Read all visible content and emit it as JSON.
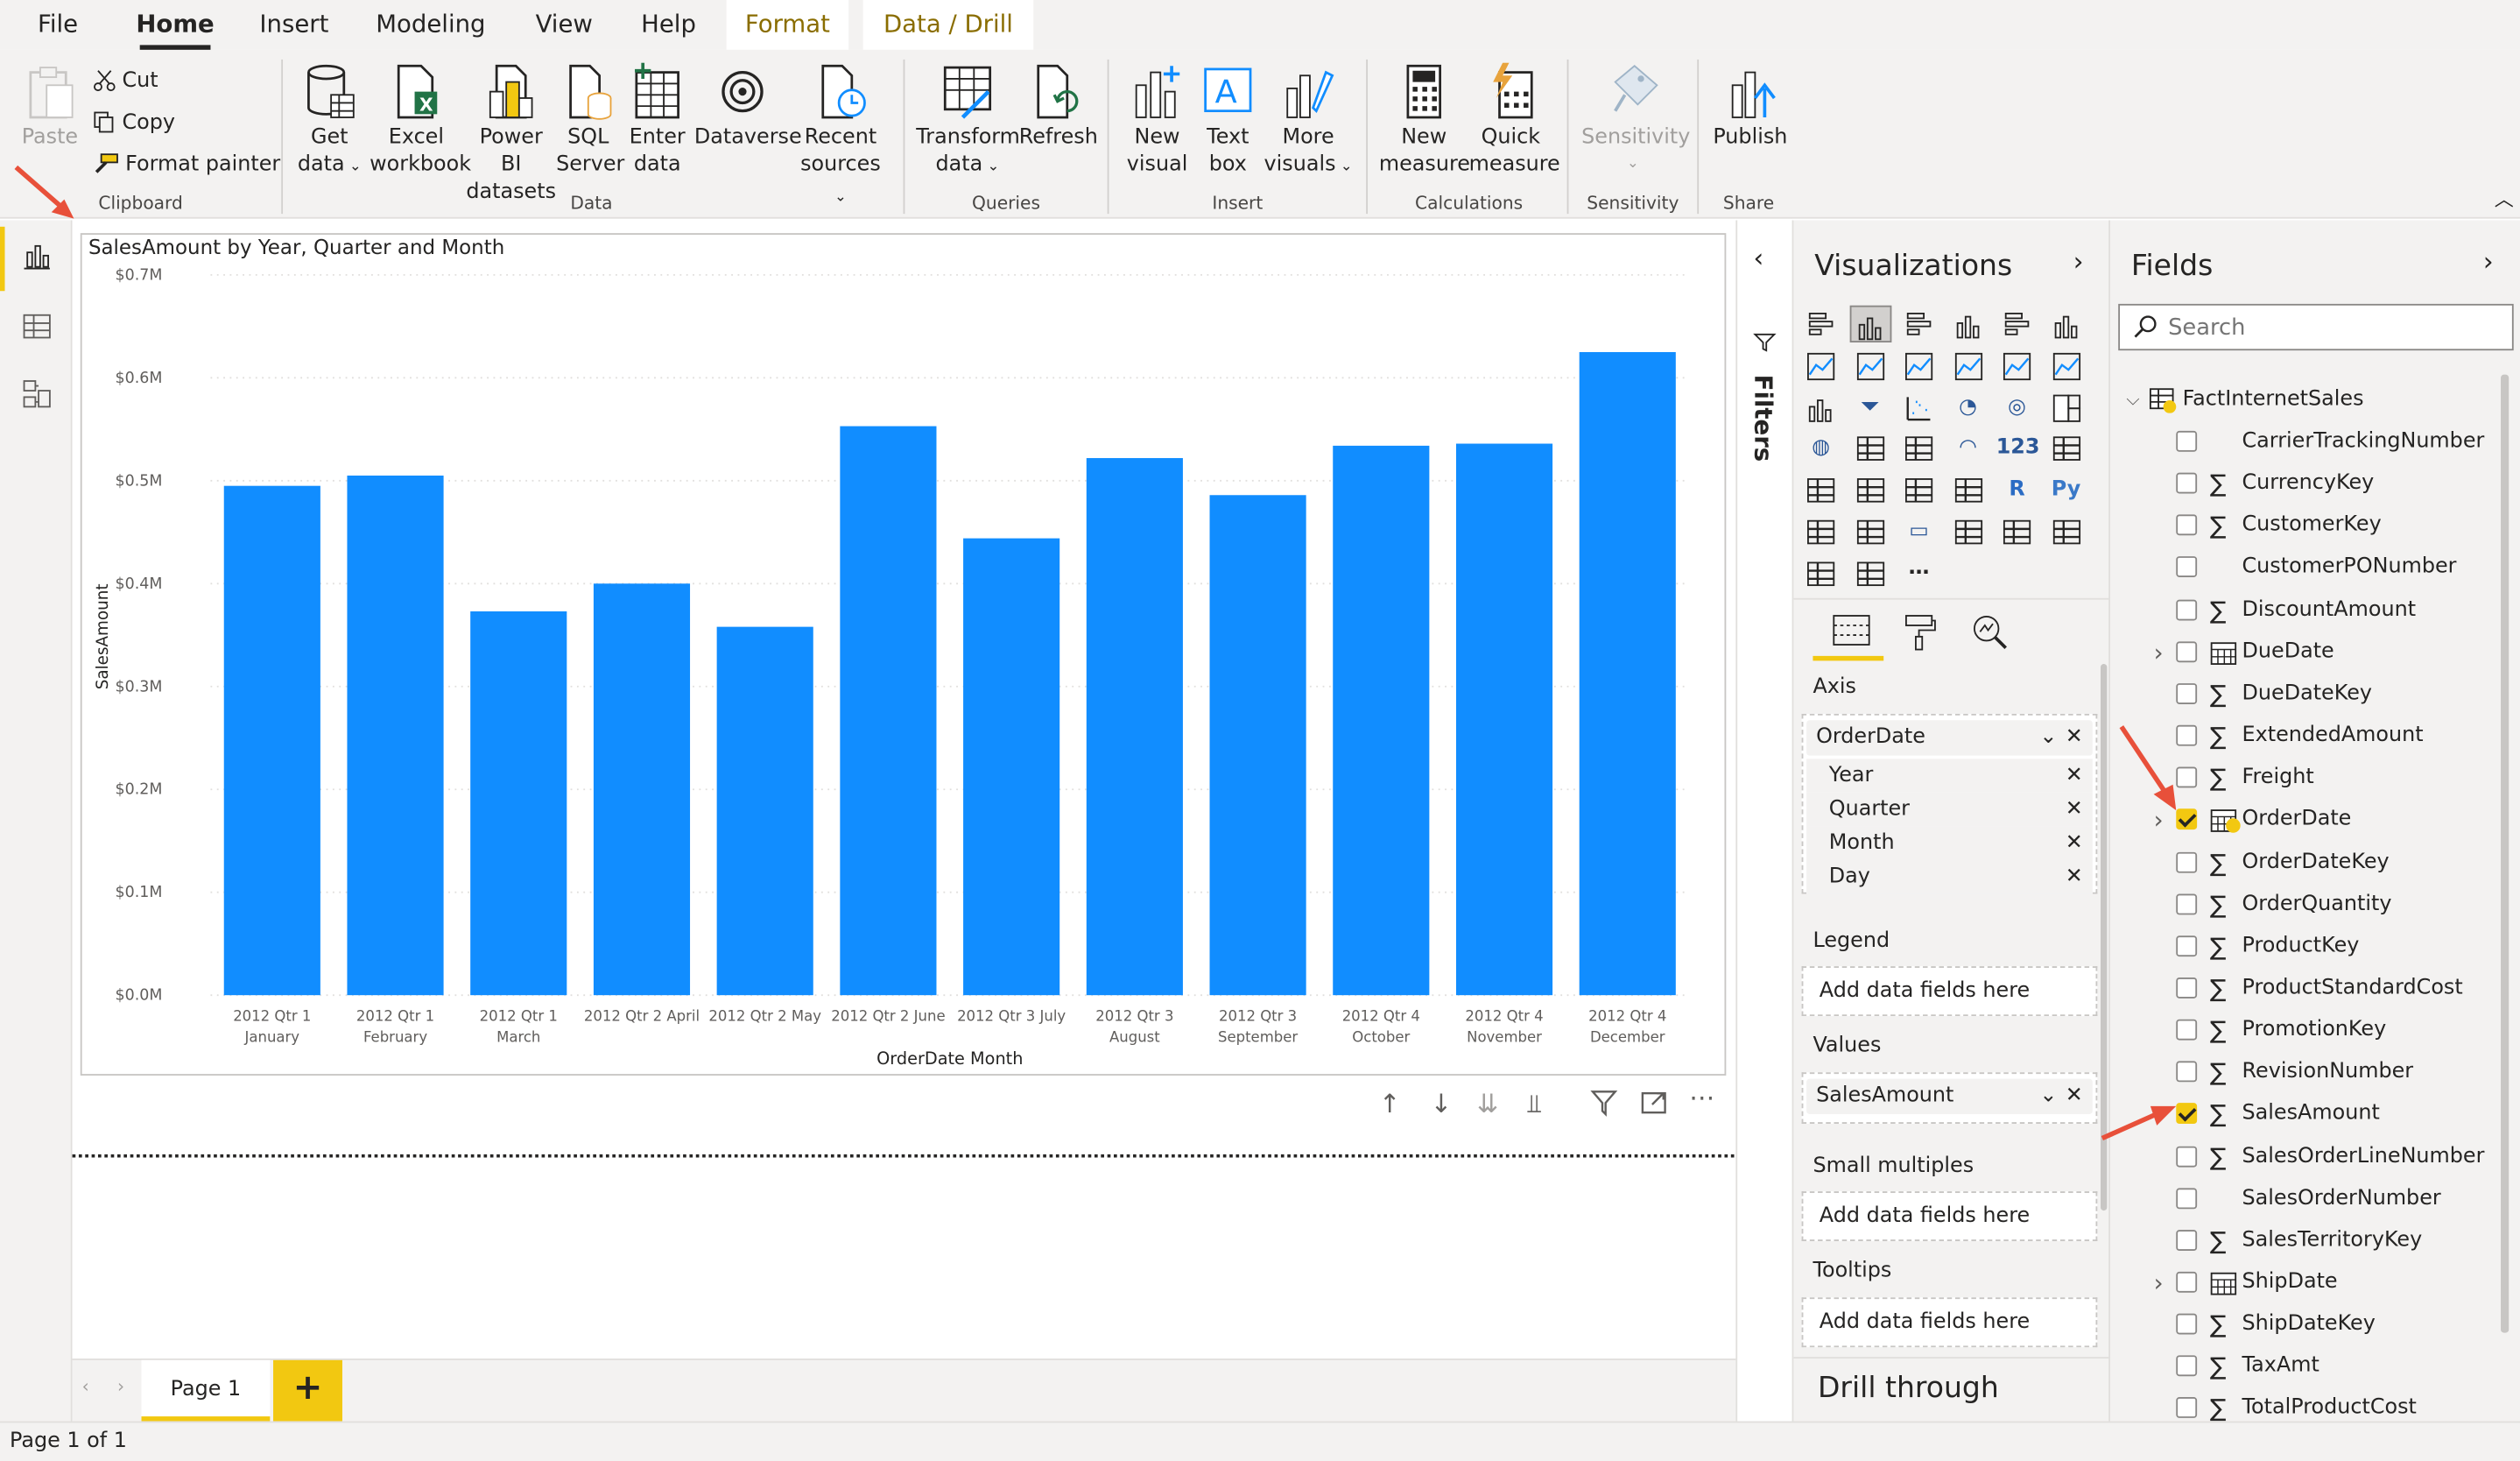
{
  "menu": {
    "tabs": [
      "File",
      "Home",
      "Insert",
      "Modeling",
      "View",
      "Help",
      "Format",
      "Data / Drill"
    ]
  },
  "ribbon": {
    "clipboard": {
      "paste": "Paste",
      "cut": "Cut",
      "copy": "Copy",
      "format_painter": "Format painter",
      "group": "Clipboard"
    },
    "data": {
      "get_data_1": "Get",
      "get_data_2": "data",
      "excel_1": "Excel",
      "excel_2": "workbook",
      "pbi_1": "Power BI",
      "pbi_2": "datasets",
      "sql_1": "SQL",
      "sql_2": "Server",
      "enter_1": "Enter",
      "enter_2": "data",
      "dataverse": "Dataverse",
      "recent_1": "Recent",
      "recent_2": "sources",
      "group": "Data"
    },
    "queries": {
      "transform_1": "Transform",
      "transform_2": "data",
      "refresh": "Refresh",
      "group": "Queries"
    },
    "insert": {
      "new_visual_1": "New",
      "new_visual_2": "visual",
      "text_box_1": "Text",
      "text_box_2": "box",
      "more_1": "More",
      "more_2": "visuals",
      "group": "Insert"
    },
    "calculations": {
      "new_measure_1": "New",
      "new_measure_2": "measure",
      "quick_1": "Quick",
      "quick_2": "measure",
      "group": "Calculations"
    },
    "sensitivity": {
      "label": "Sensitivity",
      "group": "Sensitivity"
    },
    "share": {
      "publish": "Publish",
      "group": "Share"
    }
  },
  "chart_data": {
    "type": "bar",
    "title": "SalesAmount by Year, Quarter and Month",
    "xlabel": "OrderDate Month",
    "ylabel": "SalesAmount",
    "ylim": [
      0,
      0.7
    ],
    "yticks": [
      "$0.0M",
      "$0.1M",
      "$0.2M",
      "$0.3M",
      "$0.4M",
      "$0.5M",
      "$0.6M",
      "$0.7M"
    ],
    "categories": [
      [
        "2012 Qtr 1",
        "January"
      ],
      [
        "2012 Qtr 1",
        "February"
      ],
      [
        "2012 Qtr 1",
        "March"
      ],
      [
        "2012 Qtr 2 April",
        ""
      ],
      [
        "2012 Qtr 2 May",
        ""
      ],
      [
        "2012 Qtr 2 June",
        ""
      ],
      [
        "2012 Qtr 3 July",
        ""
      ],
      [
        "2012 Qtr 3",
        "August"
      ],
      [
        "2012 Qtr 3",
        "September"
      ],
      [
        "2012 Qtr 4",
        "October"
      ],
      [
        "2012 Qtr 4",
        "November"
      ],
      [
        "2012 Qtr 4",
        "December"
      ]
    ],
    "values": [
      0.495,
      0.505,
      0.373,
      0.4,
      0.358,
      0.553,
      0.444,
      0.522,
      0.486,
      0.534,
      0.536,
      0.625
    ],
    "color": "#118dff",
    "grid": true
  },
  "pages": {
    "tab": "Page 1",
    "add": "+"
  },
  "status": "Page 1 of 1",
  "filters": {
    "label": "Filters"
  },
  "viz": {
    "title": "Visualizations",
    "axis_label": "Axis",
    "axis_field": "OrderDate",
    "axis_sub": [
      "Year",
      "Quarter",
      "Month",
      "Day"
    ],
    "legend_label": "Legend",
    "values_label": "Values",
    "values_field": "SalesAmount",
    "small_multiples_label": "Small multiples",
    "tooltips_label": "Tooltips",
    "add_placeholder": "Add data fields here",
    "drill_through": "Drill through"
  },
  "fields": {
    "title": "Fields",
    "search_placeholder": "Search",
    "table": "FactInternetSales",
    "items": [
      {
        "name": "CarrierTrackingNumber",
        "type": "text",
        "checked": false
      },
      {
        "name": "CurrencyKey",
        "type": "sigma",
        "checked": false
      },
      {
        "name": "CustomerKey",
        "type": "sigma",
        "checked": false
      },
      {
        "name": "CustomerPONumber",
        "type": "text",
        "checked": false
      },
      {
        "name": "DiscountAmount",
        "type": "sigma",
        "checked": false
      },
      {
        "name": "DueDate",
        "type": "date",
        "checked": false
      },
      {
        "name": "DueDateKey",
        "type": "sigma",
        "checked": false
      },
      {
        "name": "ExtendedAmount",
        "type": "sigma",
        "checked": false
      },
      {
        "name": "Freight",
        "type": "sigma",
        "checked": false
      },
      {
        "name": "OrderDate",
        "type": "date",
        "checked": true
      },
      {
        "name": "OrderDateKey",
        "type": "sigma",
        "checked": false
      },
      {
        "name": "OrderQuantity",
        "type": "sigma",
        "checked": false
      },
      {
        "name": "ProductKey",
        "type": "sigma",
        "checked": false
      },
      {
        "name": "ProductStandardCost",
        "type": "sigma",
        "checked": false
      },
      {
        "name": "PromotionKey",
        "type": "sigma",
        "checked": false
      },
      {
        "name": "RevisionNumber",
        "type": "sigma",
        "checked": false
      },
      {
        "name": "SalesAmount",
        "type": "sigma",
        "checked": true
      },
      {
        "name": "SalesOrderLineNumber",
        "type": "sigma",
        "checked": false
      },
      {
        "name": "SalesOrderNumber",
        "type": "text",
        "checked": false
      },
      {
        "name": "SalesTerritoryKey",
        "type": "sigma",
        "checked": false
      },
      {
        "name": "ShipDate",
        "type": "date",
        "checked": false
      },
      {
        "name": "ShipDateKey",
        "type": "sigma",
        "checked": false
      },
      {
        "name": "TaxAmt",
        "type": "sigma",
        "checked": false
      },
      {
        "name": "TotalProductCost",
        "type": "sigma",
        "checked": false
      }
    ]
  },
  "colors": {
    "accent": "#f2c811",
    "bar": "#118dff",
    "arrow": "#e8503a"
  }
}
